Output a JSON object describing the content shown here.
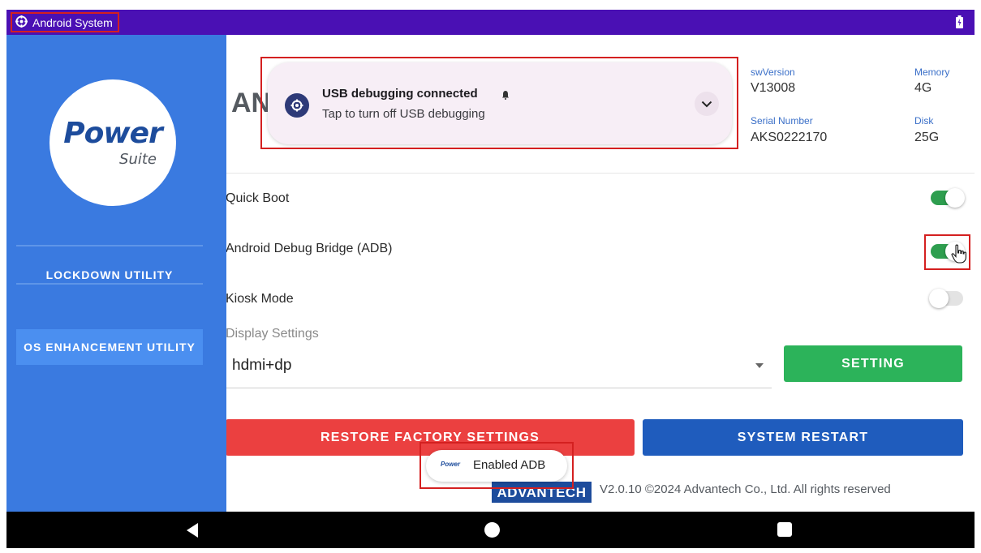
{
  "status_bar": {
    "app_label": "Android System",
    "gear_icon": "gear-icon",
    "battery_icon": "battery-charging-icon",
    "background_color": "#4a10b4"
  },
  "sidebar": {
    "logo": {
      "word": "Power",
      "subword": "Suite"
    },
    "items": [
      {
        "label": "LOCKDOWN UTILITY",
        "active": false
      },
      {
        "label": "OS ENHANCEMENT UTILITY",
        "active": true
      }
    ],
    "background_color": "#3a7ae0"
  },
  "main": {
    "title_partial": "AN",
    "device_info": {
      "sw_version_label": "swVersion",
      "sw_version_value": "V13008",
      "memory_label": "Memory",
      "memory_value": "4G",
      "serial_label": "Serial Number",
      "serial_value": "AKS0222170",
      "disk_label": "Disk",
      "disk_value": "25G"
    },
    "settings": [
      {
        "label": "Quick Boot",
        "enabled": true
      },
      {
        "label": "Android Debug Bridge (ADB)",
        "enabled": true
      },
      {
        "label": "Kiosk Mode",
        "enabled": false
      }
    ],
    "display_settings": {
      "label": "Display Settings",
      "selected": "hdmi+dp",
      "button_label": "SETTING"
    },
    "actions": {
      "restore_label": "RESTORE FACTORY SETTINGS",
      "restart_label": "SYSTEM RESTART"
    },
    "footer": {
      "brand": "ADVANTECH",
      "copyright": "V2.0.10 ©2024 Advantech Co., Ltd.  All rights reserved"
    }
  },
  "notification": {
    "title": "USB debugging connected",
    "subtitle": "Tap to turn off USB debugging",
    "icon": "gear-icon",
    "expand_icon": "chevron-down-icon"
  },
  "toast": {
    "logo": "Power",
    "message": "Enabled ADB"
  },
  "nav_bar": {
    "back": "back-icon",
    "home": "home-icon",
    "recents": "recents-icon"
  },
  "colors": {
    "accent_green": "#2cb35a",
    "danger_red": "#eb4040",
    "primary_blue": "#1f5cbd"
  }
}
